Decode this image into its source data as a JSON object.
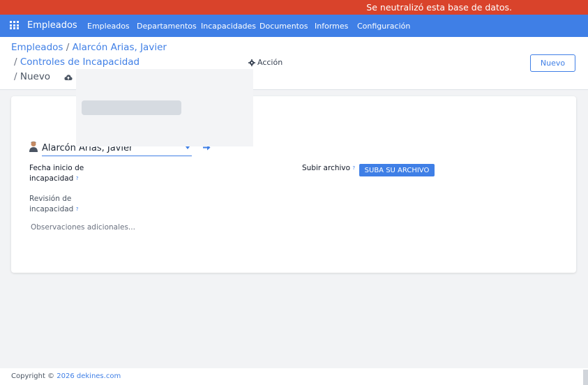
{
  "banner": {
    "text": "Se neutralizó esta base de datos."
  },
  "navbar": {
    "app_name": "Empleados",
    "menu": [
      "Empleados",
      "Departamentos",
      "Incapacidades",
      "Documentos",
      "Informes",
      "Configuración"
    ]
  },
  "breadcrumb": {
    "items": [
      "Empleados",
      "Alarcón Arias, Javier",
      "Controles de Incapacidad"
    ],
    "current": "Nuevo",
    "separator": "/"
  },
  "toolbar": {
    "action_label": "Acción",
    "new_label": "Nuevo"
  },
  "form": {
    "employee_value": "Alarcón Arias, Javier",
    "start_date_label_line1": "Fecha inicio de",
    "start_date_label_line2": "incapacidad",
    "review_label_line1": "Revisión de",
    "review_label_line2": "incapacidad",
    "tooltip_mark": "?",
    "upload_label": "Subir archivo",
    "upload_button": "SUBA SU ARCHIVO",
    "notes_placeholder": "Observaciones adicionales..."
  },
  "footer": {
    "copyright": "Copyright ©",
    "year": "2026",
    "site": "dekines.com"
  },
  "colors": {
    "brand": "#3f7fe6",
    "banner": "#d9432b"
  }
}
